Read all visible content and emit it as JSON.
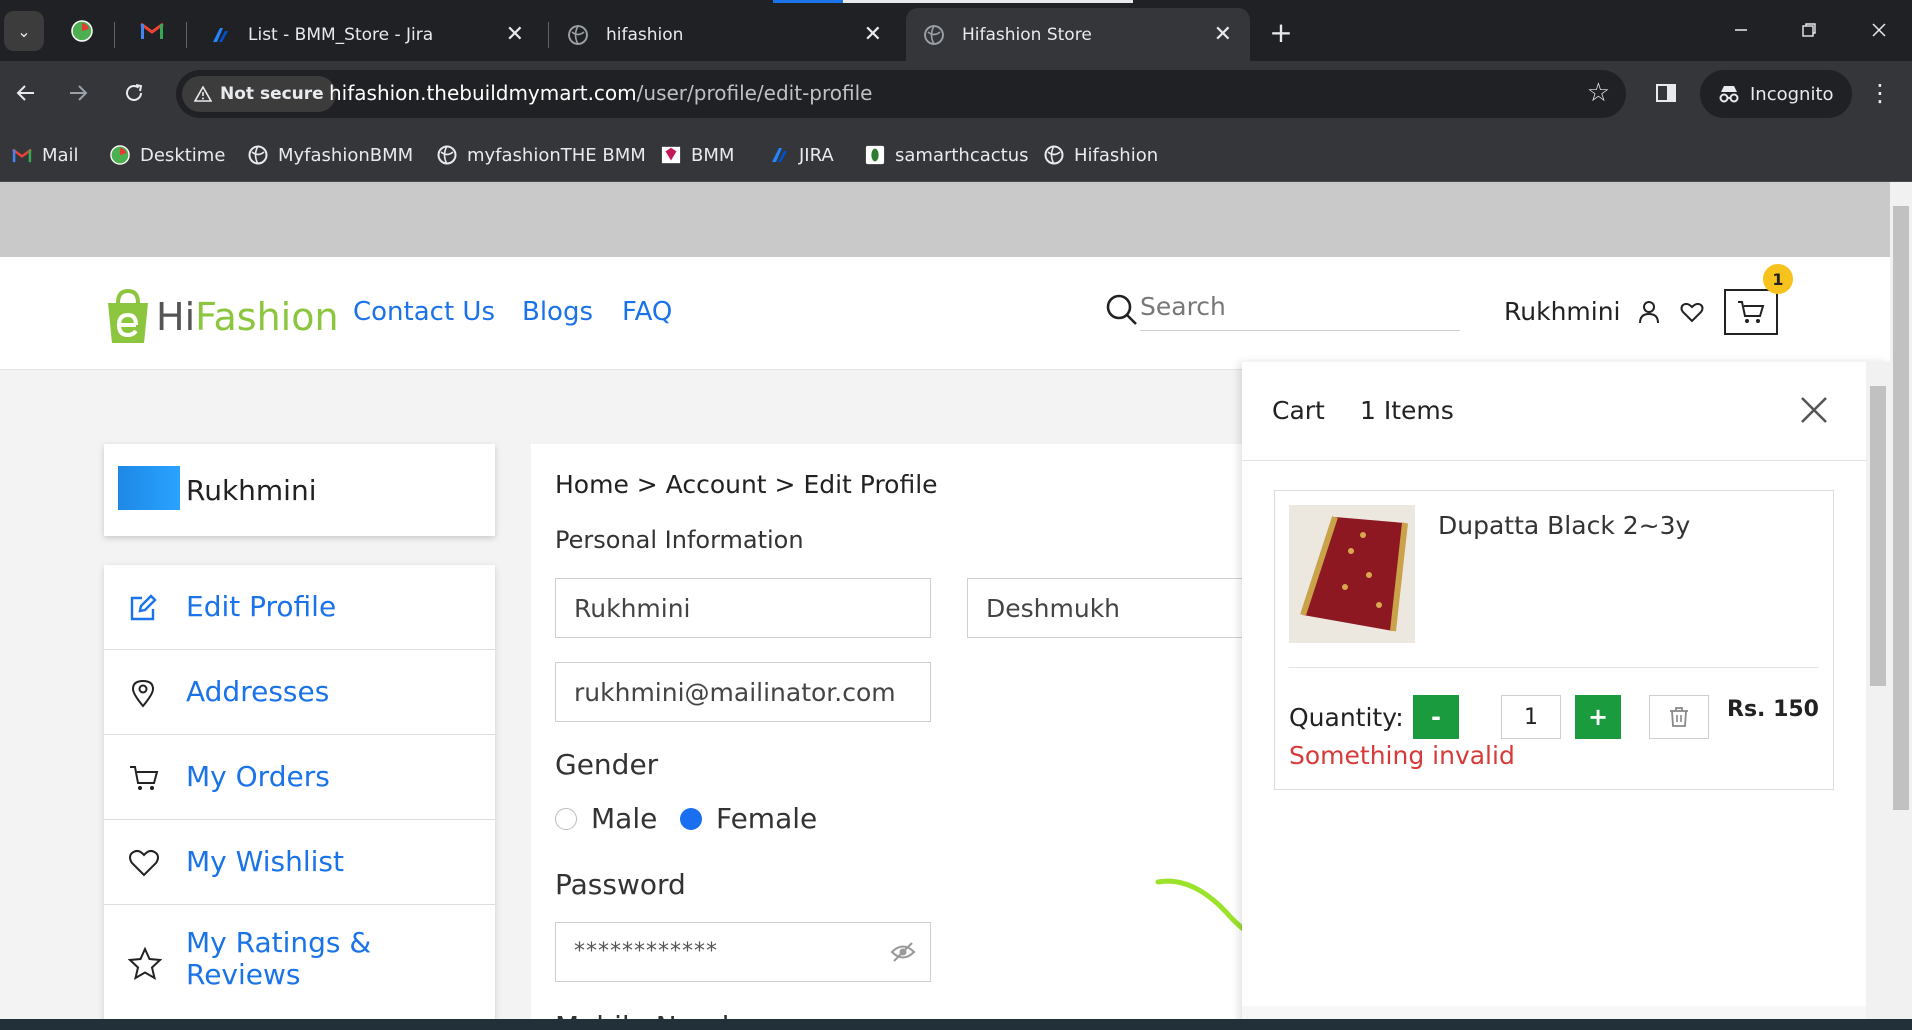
{
  "browser": {
    "tabs": [
      {
        "title": "List - BMM_Store - Jira",
        "close": "✕"
      },
      {
        "title": "hifashion",
        "close": "✕"
      },
      {
        "title": "Hifashion Store",
        "close": "✕"
      }
    ],
    "new_tab": "+",
    "security_label": "Not secure",
    "url_host": "hifashion.thebuildmymart.com",
    "url_path": "/user/profile/edit-profile",
    "incognito_label": "Incognito",
    "bookmarks": [
      "Mail",
      "Desktime",
      "MyfashionBMM",
      "myfashionTHE BMM",
      "BMM",
      "JIRA",
      "samarthcactus",
      "Hifashion"
    ]
  },
  "site": {
    "logo_hi": "Hi",
    "logo_fashion": "Fashion",
    "nav": [
      "Contact Us",
      "Blogs",
      "FAQ"
    ],
    "search_placeholder": "Search",
    "username": "Rukhmini",
    "cart_badge": "1"
  },
  "sidebar": {
    "profile_name": "Rukhmini",
    "items": [
      {
        "label": "Edit Profile",
        "icon": "edit-icon"
      },
      {
        "label": "Addresses",
        "icon": "location-pin-icon"
      },
      {
        "label": "My Orders",
        "icon": "cart-icon"
      },
      {
        "label": "My Wishlist",
        "icon": "heart-icon"
      },
      {
        "label": "My Ratings & Reviews",
        "icon": "star-icon"
      }
    ]
  },
  "profile": {
    "breadcrumb": "Home > Account > Edit Profile",
    "section_title": "Personal Information",
    "first_name": "Rukhmini",
    "last_name": "Deshmukh",
    "email": "rukhmini@mailinator.com",
    "gender_label": "Gender",
    "gender_male": "Male",
    "gender_female": "Female",
    "gender_selected": "Female",
    "password_label": "Password",
    "password_mask": "************",
    "mobile_label": "Mobile Number"
  },
  "cart": {
    "title": "Cart",
    "count_label": "1 Items",
    "item": {
      "name": "Dupatta Black 2~3y",
      "quantity_label": "Quantity:",
      "minus": "-",
      "quantity": "1",
      "plus": "+",
      "price": "Rs. 150",
      "error": "Something invalid"
    }
  },
  "colors": {
    "accent_blue": "#1a73e8",
    "brand_green": "#8cc63f",
    "qty_green": "#1a9c3e",
    "error_red": "#d83a3a",
    "annotation_green": "#9be22a"
  }
}
